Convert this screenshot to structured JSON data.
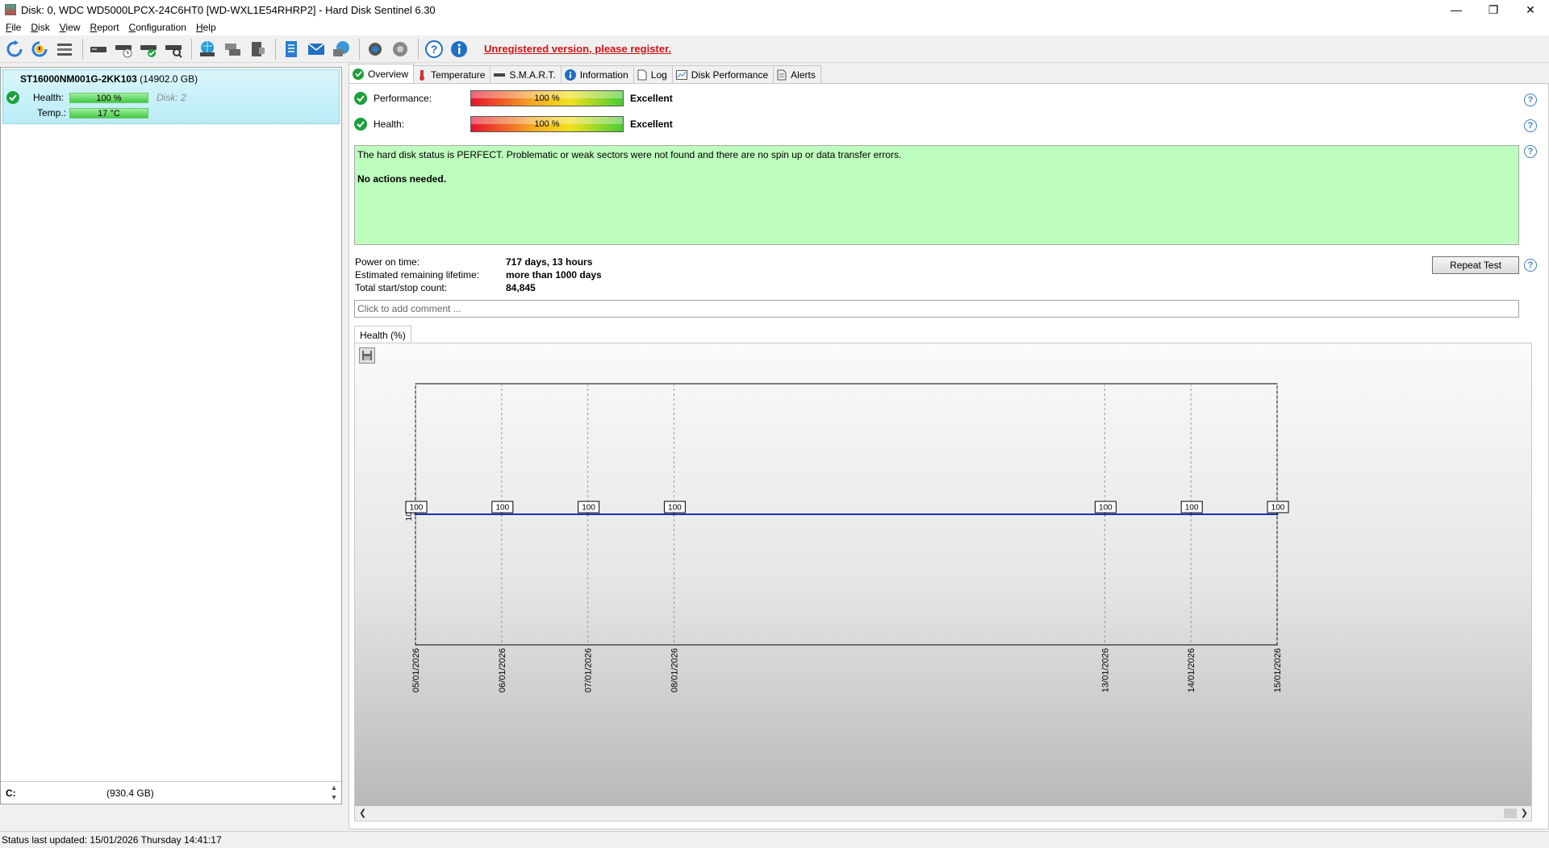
{
  "window": {
    "title": "Disk: 0, WDC WD5000LPCX-24C6HT0 [WD-WXL1E54RHRP2]  -  Hard Disk Sentinel 6.30",
    "minimize": "—",
    "maximize": "❐",
    "close": "✕"
  },
  "menu": {
    "file": {
      "u": "F",
      "rest": "ile"
    },
    "disk": {
      "u": "D",
      "rest": "isk"
    },
    "view": {
      "u": "V",
      "rest": "iew"
    },
    "report": {
      "u": "R",
      "rest": "eport"
    },
    "configuration": {
      "u": "C",
      "rest": "onfiguration"
    },
    "help": {
      "u": "H",
      "rest": "elp"
    }
  },
  "toolbar": {
    "register_link": "Unregistered version, please register."
  },
  "disk_list": {
    "model": "ST16000NM001G-2KK103",
    "capacity": "(14902.0 GB)",
    "health_label": "Health:",
    "health_value": "100 %",
    "disk_index": "Disk: 2",
    "temp_label": "Temp.:",
    "temp_value": "17 °C",
    "drive_letter": "C:",
    "drive_size": "(930.4 GB)"
  },
  "tabs": {
    "overview": "Overview",
    "temperature": "Temperature",
    "smart": "S.M.A.R.T.",
    "information": "Information",
    "log": "Log",
    "disk_performance": "Disk Performance",
    "alerts": "Alerts"
  },
  "overview": {
    "performance_label": "Performance:",
    "performance_value": "100 %",
    "performance_status": "Excellent",
    "health_label": "Health:",
    "health_value": "100 %",
    "health_status": "Excellent",
    "status_text": "The hard disk status is PERFECT. Problematic or weak sectors were not found and there are no spin up or data transfer errors.",
    "action_text": "No actions needed.",
    "power_on_label": "Power on time:",
    "power_on_value": "717 days, 13 hours",
    "lifetime_label": "Estimated remaining lifetime:",
    "lifetime_value": "more than 1000 days",
    "startstop_label": "Total start/stop count:",
    "startstop_value": "84,845",
    "repeat_test": "Repeat Test",
    "comment_placeholder": "Click to add comment ...",
    "graph_tab": "Health (%)",
    "help": "?"
  },
  "colors": {
    "status_ok": "#bdfdbd",
    "line": "#1a2fa8",
    "register": "#d01515"
  },
  "chart_data": {
    "type": "line",
    "title": "",
    "xlabel": "",
    "ylabel": "",
    "x": [
      "05/01/2026",
      "06/01/2026",
      "07/01/2026",
      "08/01/2026",
      "13/01/2026",
      "14/01/2026",
      "15/01/2026"
    ],
    "series": [
      {
        "values": [
          100,
          100,
          100,
          100,
          100,
          100,
          100
        ]
      }
    ],
    "y_tick_label": "100",
    "ylim": [
      90,
      110
    ],
    "grid": "vertical dashed",
    "data_labels": true
  },
  "statusbar": {
    "text": "Status last updated: 15/01/2026 Thursday 14:41:17"
  }
}
